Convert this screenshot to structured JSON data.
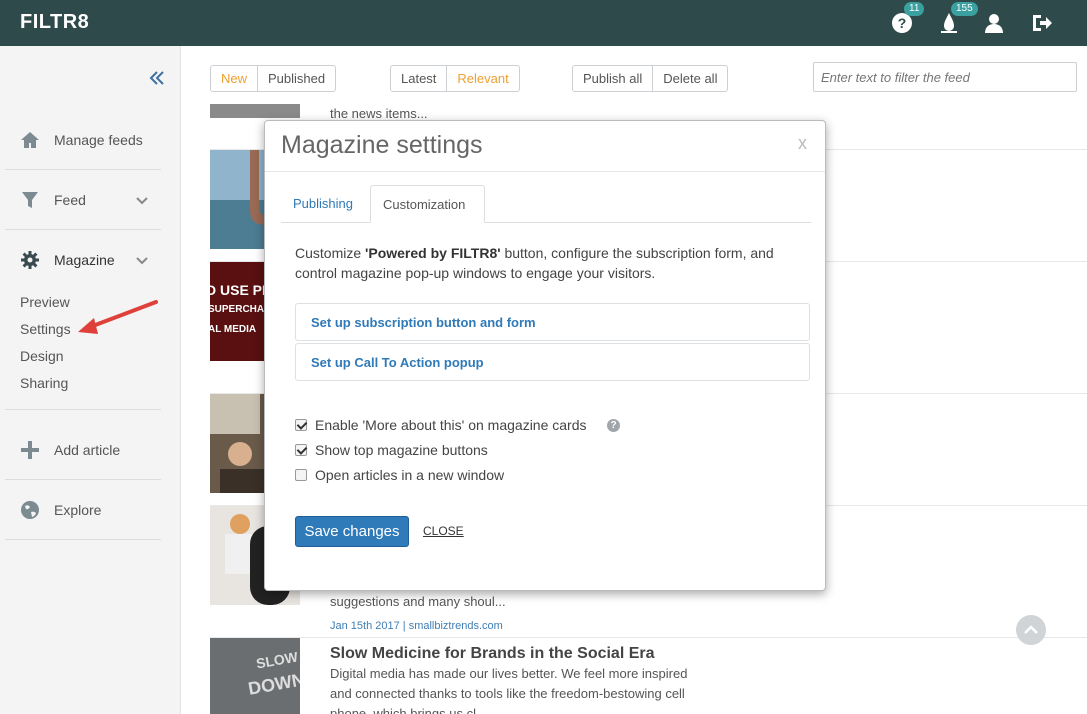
{
  "header": {
    "brand": "FILTR8",
    "help_badge": "11",
    "notifications_badge": "155",
    "bg_color": "#2f4a4a"
  },
  "sidebar": {
    "items": [
      {
        "label": "Manage feeds",
        "icon": "home-icon"
      },
      {
        "label": "Feed",
        "icon": "filter-icon"
      },
      {
        "label": "Magazine",
        "icon": "gear-icon"
      },
      {
        "label": "Add article",
        "icon": "plus-icon"
      },
      {
        "label": "Explore",
        "icon": "globe-icon"
      }
    ],
    "magazine_sub": [
      "Preview",
      "Settings",
      "Design",
      "Sharing"
    ]
  },
  "toolbar": {
    "new": "New",
    "published": "Published",
    "latest": "Latest",
    "relevant": "Relevant",
    "publish_all": "Publish all",
    "delete_all": "Delete all",
    "filter_placeholder": "Enter text to filter the feed"
  },
  "feed": {
    "snippet_top": "the news items...",
    "snippet_mid": "suggestions and many shoul...",
    "meta": "Jan 15th 2017 | smallbiztrends.com",
    "article_title": "Slow Medicine for Brands in the Social Era",
    "article_line1": "Digital media has made our lives better. We feel more inspired",
    "article_line2": "and connected thanks to tools like the freedom-bestowing cell",
    "article_line3": "phone, which brings us cl...",
    "thumb_text_1": "D USE PI",
    "thumb_text_2": "SUPERCHA",
    "thumb_text_3": "AL MEDIA",
    "thumb_text_4": "SLOW",
    "thumb_text_5": "DOWN"
  },
  "modal": {
    "title": "Magazine settings",
    "close_x": "x",
    "tabs": [
      "Publishing",
      "Customization"
    ],
    "desc_pre": "Customize ",
    "desc_bold": "'Powered by FILTR8'",
    "desc_post": " button, configure the subscription form, and control magazine pop-up windows to engage your visitors.",
    "links": [
      "Set up subscription button and form",
      "Set up Call To Action popup"
    ],
    "checkboxes": [
      {
        "label": "Enable 'More about this' on magazine cards",
        "checked": true
      },
      {
        "label": "Show top magazine buttons",
        "checked": true
      },
      {
        "label": "Open articles in a new window",
        "checked": false
      }
    ],
    "help_glyph": "?",
    "save_label": "Save changes",
    "close_label": "CLOSE"
  },
  "colors": {
    "accent_blue": "#2f7ab8",
    "accent_orange": "#f0a030",
    "arrow_red": "#e0403a"
  }
}
